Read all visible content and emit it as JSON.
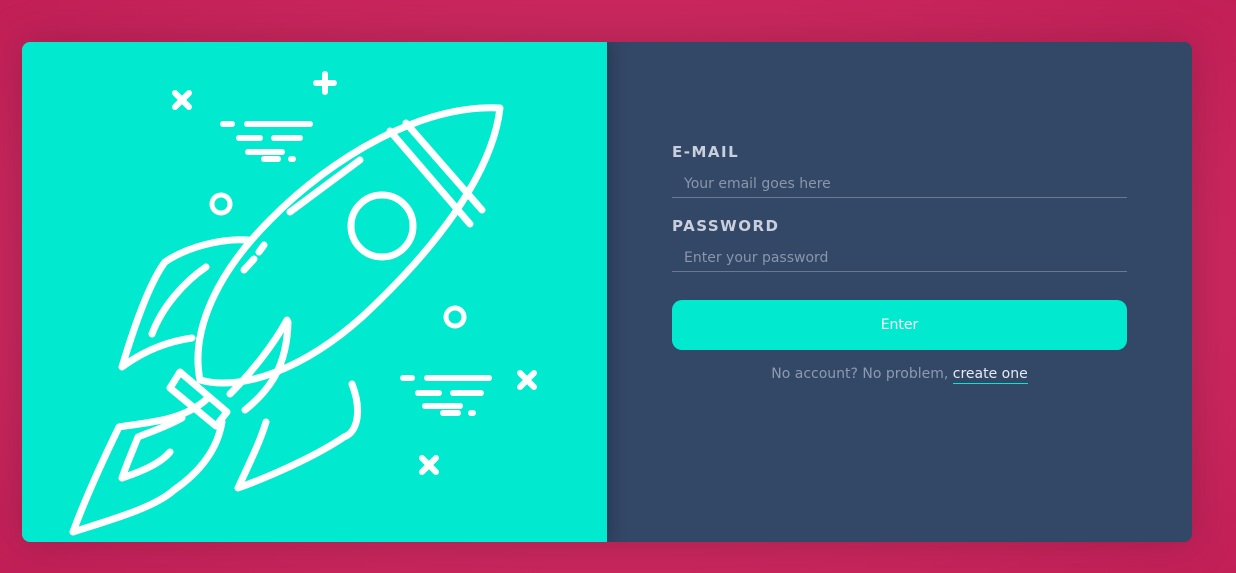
{
  "illustration": {
    "icon": "rocket-icon",
    "background_color": "#01eacf",
    "line_color": "#ffffff"
  },
  "login_form": {
    "email": {
      "label": "E-MAIL",
      "placeholder": "Your email goes here",
      "value": ""
    },
    "password": {
      "label": "PASSWORD",
      "placeholder": "Enter your password",
      "value": ""
    },
    "submit_label": "Enter",
    "signup_prompt": "No account? No problem,",
    "signup_link": "create one"
  },
  "colors": {
    "page_background": "#d0306a",
    "panel_background": "#334767",
    "accent": "#01eacf"
  }
}
